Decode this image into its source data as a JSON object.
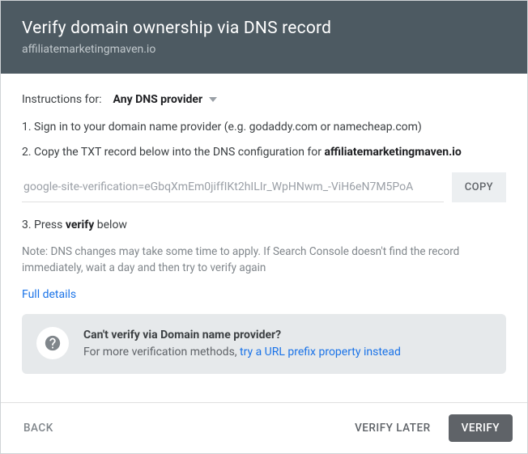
{
  "header": {
    "title": "Verify domain ownership via DNS record",
    "domain": "affiliatemarketingmaven.io"
  },
  "instructions": {
    "label": "Instructions for:",
    "provider": "Any DNS provider",
    "step1": "1. Sign in to your domain name provider (e.g. godaddy.com or namecheap.com)",
    "step2_prefix": "2. Copy the TXT record below into the DNS configuration for ",
    "step2_domain": "affiliatemarketingmaven.io",
    "txt_value": "google-site-verification=eGbqXmEm0jiffIKt2hILIr_WpHNwm_-ViH6eN7M5PoA",
    "copy_label": "COPY",
    "step3_prefix": "3. Press ",
    "step3_bold": "verify",
    "step3_suffix": " below"
  },
  "note": "Note: DNS changes may take some time to apply. If Search Console doesn't find the record immediately, wait a day and then try to verify again",
  "full_details": "Full details",
  "alt": {
    "title": "Can't verify via Domain name provider?",
    "line_prefix": "For more verification methods, ",
    "link": "try a URL prefix property instead"
  },
  "footer": {
    "back": "BACK",
    "verify_later": "VERIFY LATER",
    "verify": "VERIFY"
  }
}
